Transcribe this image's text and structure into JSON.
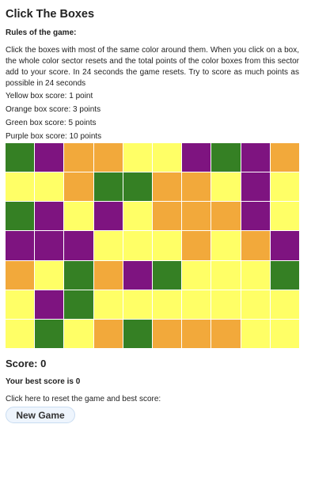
{
  "title": "Click The Boxes",
  "rules": {
    "heading": "Rules of the game:",
    "text": "Click the boxes with most of the same color around them. When you click on a box, the whole color sector resets and the total points of the color boxes from this sector add to your score. In 24 seconds the game resets. Try to score as much points as possible in 24 seconds"
  },
  "box_scores": [
    "Yellow box score: 1 point",
    "Orange box score: 3 points",
    "Green box score: 5 points",
    "Purple box score: 10 points"
  ],
  "colors": {
    "Y": "#ffff66",
    "O": "#f2a93b",
    "G": "#358024",
    "P": "#7e1480"
  },
  "grid": [
    [
      "G",
      "P",
      "O",
      "O",
      "Y",
      "Y",
      "P",
      "G",
      "P",
      "O"
    ],
    [
      "Y",
      "Y",
      "O",
      "G",
      "G",
      "O",
      "O",
      "Y",
      "P",
      "Y"
    ],
    [
      "G",
      "P",
      "Y",
      "P",
      "Y",
      "O",
      "O",
      "O",
      "P",
      "Y"
    ],
    [
      "P",
      "P",
      "P",
      "Y",
      "Y",
      "Y",
      "O",
      "Y",
      "O",
      "P"
    ],
    [
      "O",
      "Y",
      "G",
      "O",
      "P",
      "G",
      "Y",
      "Y",
      "Y",
      "G"
    ],
    [
      "Y",
      "P",
      "G",
      "Y",
      "Y",
      "Y",
      "Y",
      "Y",
      "Y",
      "Y"
    ],
    [
      "Y",
      "G",
      "Y",
      "O",
      "G",
      "O",
      "O",
      "O",
      "Y",
      "Y"
    ]
  ],
  "score_label": "Score: 0",
  "best_score_label": "Your best score is 0",
  "reset_prompt": "Click here to reset the game and best score:",
  "new_game_label": "New Game"
}
